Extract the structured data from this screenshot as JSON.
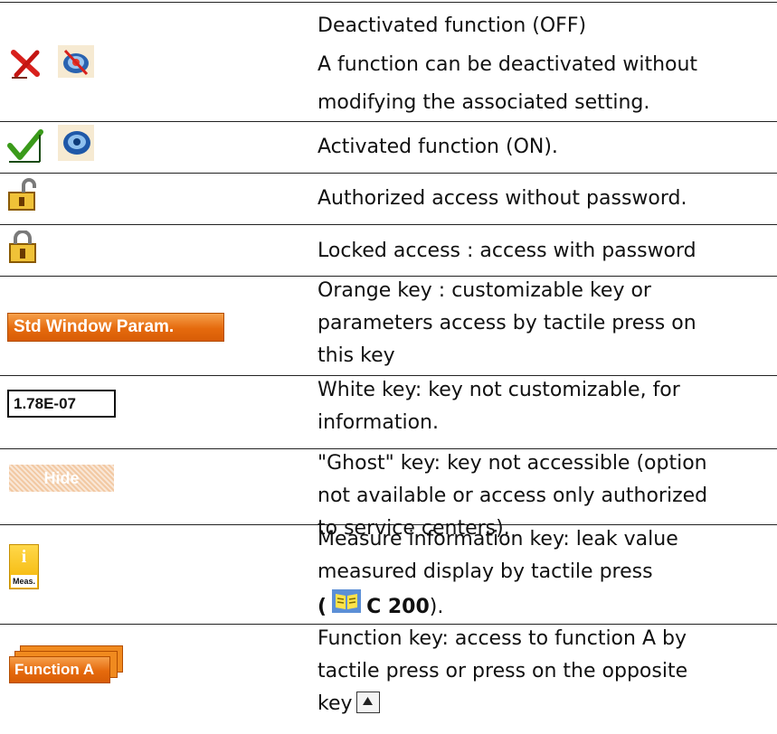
{
  "rows": {
    "off": {
      "line1": "Deactivated function (OFF)",
      "line2": "A function can be deactivated without",
      "line3": "modifying the associated setting."
    },
    "on": {
      "text": "Activated function (ON)."
    },
    "unlocked": {
      "text": "Authorized access without password."
    },
    "locked": {
      "text": "Locked access : access with password"
    },
    "orange_key": {
      "key_label": "Std Window Param.",
      "line1": "Orange key : customizable key or",
      "line2": "parameters access by tactile press on",
      "line3": "this key"
    },
    "white_key": {
      "key_label": "1.78E-07",
      "line1": "White key: key not customizable, for",
      "line2": "information."
    },
    "ghost_key": {
      "key_label": "Hide",
      "line1": "\"Ghost\" key: key not accessible (option",
      "line2": "not available or access only authorized",
      "line3": "to service centers)."
    },
    "measure_key": {
      "key_label": "Meas.",
      "key_icon": "i",
      "line1": "Measure information key: leak value",
      "line2": "measured display by tactile press",
      "ref_open": "(",
      "ref": "C 200",
      "ref_close": ")."
    },
    "function_key": {
      "key_label": "Function A",
      "line1": "Function key: access to function A by",
      "line2": "tactile press or press on the opposite",
      "line3": "key"
    }
  },
  "colors": {
    "orange_key": "#e56a0d",
    "ghost_key": "#f2c9a3",
    "meas_key": "#f3b300",
    "cross": "#d8201c",
    "check": "#3a9a1a"
  },
  "icons": [
    "cross-icon",
    "speaker-muted-icon",
    "check-icon",
    "speaker-icon",
    "padlock-open-icon",
    "padlock-closed-icon",
    "book-icon",
    "up-arrow-key-icon"
  ]
}
